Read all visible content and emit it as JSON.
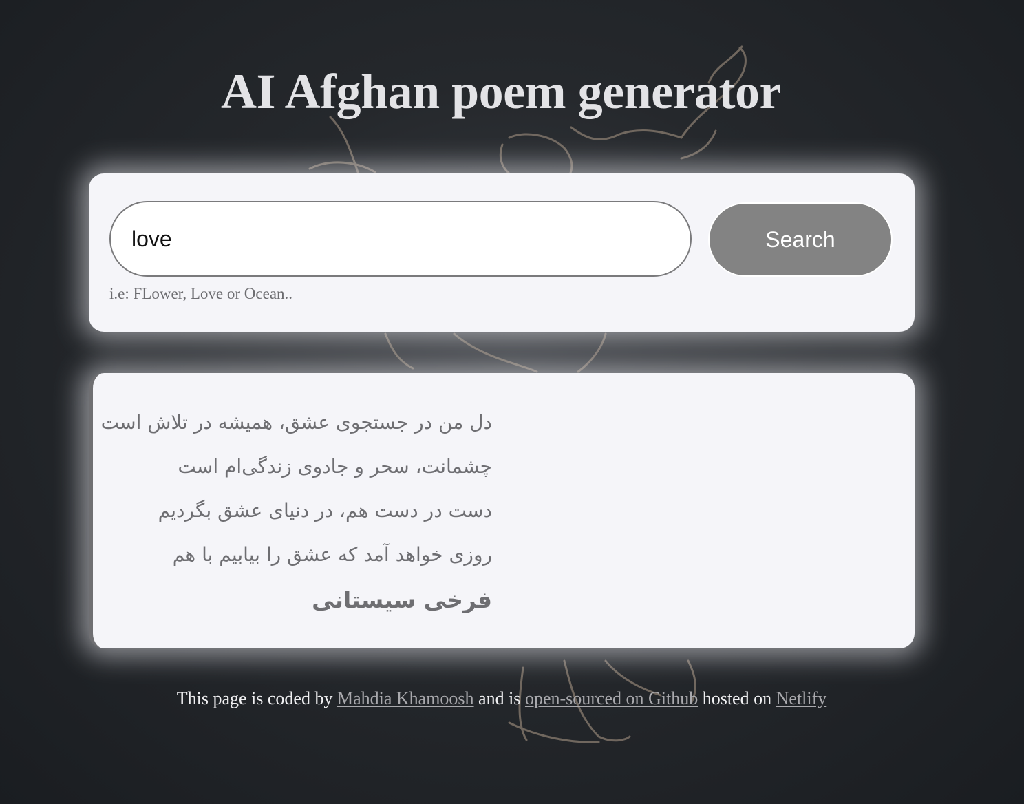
{
  "page": {
    "title": "AI Afghan poem generator"
  },
  "search": {
    "value": "love",
    "button_label": "Search",
    "hint": "i.e: FLower, Love or Ocean.."
  },
  "poem": {
    "lines": [
      "دل من در جستجوی عشق، همیشه در تلاش است",
      "چشمانت، سحر و جادوی زندگی‌ام است",
      "دست در دست هم، در دنیای عشق بگردیم",
      "روزی خواهد آمد که عشق را بیابیم با هم"
    ],
    "poet": "فرخی سیستانی"
  },
  "footer": {
    "text_1": "This page is coded by",
    "author_link": "Mahdia Khamoosh",
    "text_2": "and is",
    "github_link": "open-sourced on Github",
    "text_3": "hosted on",
    "host_link": "Netlify"
  },
  "colors": {
    "background": "#1f2226",
    "card": "#f5f5f9",
    "button": "#838383",
    "title": "#e3e3e6",
    "poem_text": "#6e6e72",
    "link": "#a9a9ad"
  }
}
